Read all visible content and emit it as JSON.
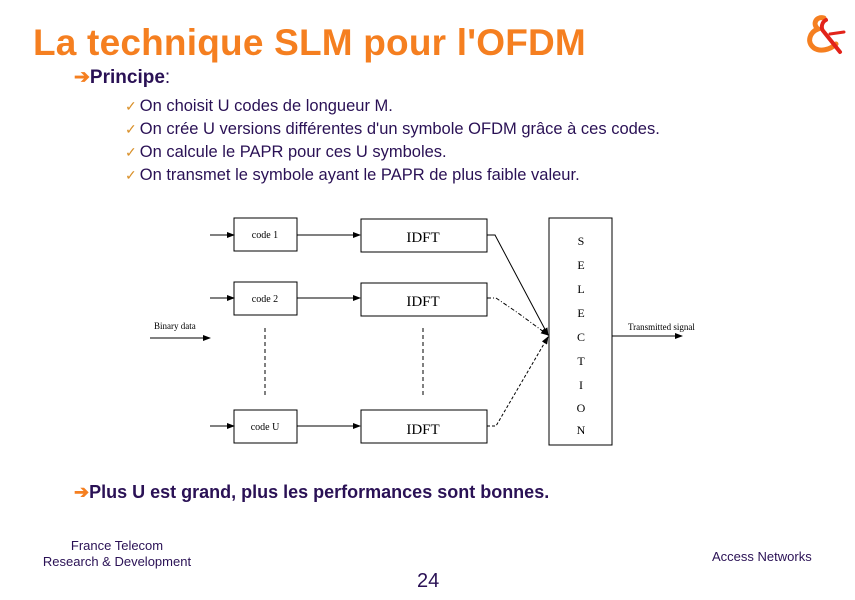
{
  "slide": {
    "title": "La technique SLM pour l'OFDM",
    "logo": "france-telecom-ampersand-logo",
    "section_arrow": "➔",
    "section_label": "Principe",
    "section_colon": ":",
    "bullets": [
      "On choisit U  codes de longueur M.",
      "On crée U versions différentes d'un symbole OFDM grâce à ces codes.",
      "On calcule le PAPR pour ces U symboles.",
      "On transmet le symbole ayant le PAPR de plus faible valeur."
    ],
    "bullet_icon": "✓",
    "conclusion": "Plus U est grand, plus les performances sont bonnes.",
    "colors": {
      "title": "#f57f20",
      "text": "#2a1155",
      "check": "#d9902a"
    }
  },
  "diagram": {
    "input_label": "Binary data",
    "output_label": "Transmitted signal",
    "codes": [
      "code 1",
      "code 2",
      "code U"
    ],
    "idft_label": "IDFT",
    "selection_letters": [
      "S",
      "E",
      "L",
      "E",
      "C",
      "T",
      "I",
      "O",
      "N"
    ]
  },
  "footer": {
    "org_line1": "France Telecom",
    "org_line2": "Research & Development",
    "division": "Access Networks",
    "page_number": "24"
  }
}
